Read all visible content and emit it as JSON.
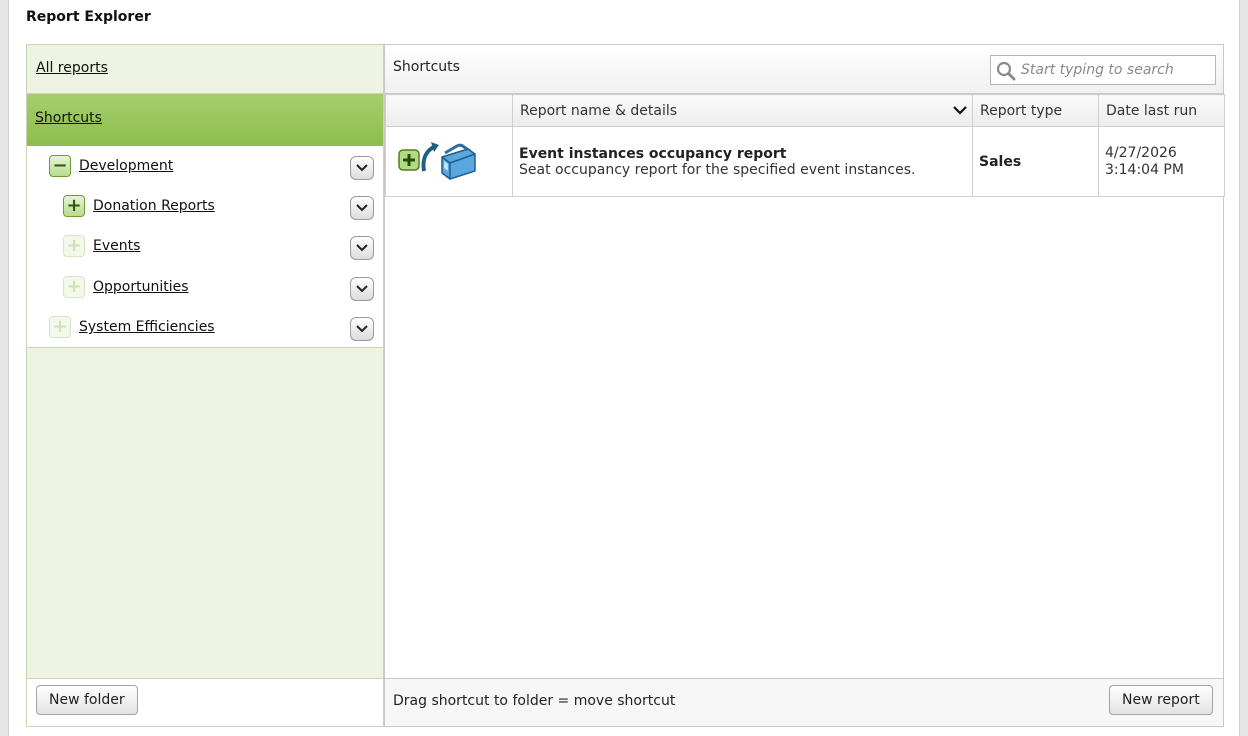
{
  "window": {
    "title": "Report Explorer"
  },
  "tree": {
    "all_reports": "All reports",
    "shortcuts": "Shortcuts",
    "items": [
      {
        "label": "Development",
        "state": "expanded"
      },
      {
        "label": "Donation Reports",
        "state": "collapsed"
      },
      {
        "label": "Events",
        "state": "empty"
      },
      {
        "label": "Opportunities",
        "state": "empty"
      },
      {
        "label": "System Efficiencies",
        "state": "empty"
      }
    ],
    "new_folder_label": "New folder"
  },
  "main": {
    "heading": "Shortcuts",
    "search_placeholder": "Start typing to search",
    "columns": {
      "icon": "",
      "name": "Report name & details",
      "type": "Report type",
      "date": "Date last run"
    },
    "rows": [
      {
        "name": "Event instances occupancy report",
        "description": "Seat occupancy report for the specified event instances.",
        "type": "Sales",
        "date_line1": "4/27/2026",
        "date_line2": "3:14:04 PM"
      }
    ],
    "footer_hint": "Drag shortcut to folder = move shortcut",
    "new_report_label": "New report"
  },
  "icons": {
    "expand": "plus-icon",
    "collapse": "minus-icon",
    "menu": "chevron-down-icon",
    "search": "magnifier-icon",
    "report": "report-toolbox-icon"
  },
  "colors": {
    "tree_background": "#eef3e2",
    "selected_green": "#9bc85e",
    "toggle_green": "#6f9a3a"
  }
}
